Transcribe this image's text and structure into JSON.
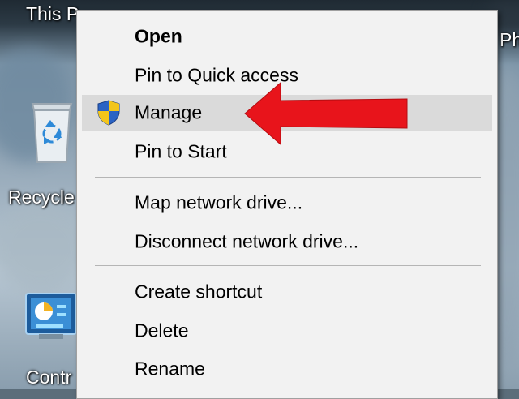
{
  "desktop": {
    "top_labels": [
      "This P",
      "Ph"
    ],
    "icons": [
      {
        "name": "recycle-bin",
        "label": "Recycle"
      },
      {
        "name": "control-panel",
        "label": "Contr"
      }
    ]
  },
  "context_menu": {
    "items": [
      {
        "label": "Open",
        "bold": true
      },
      {
        "label": "Pin to Quick access"
      },
      {
        "label": "Manage",
        "icon": "shield-icon",
        "highlighted": true
      },
      {
        "label": "Pin to Start"
      },
      {
        "label": "Map network drive..."
      },
      {
        "label": "Disconnect network drive..."
      },
      {
        "label": "Create shortcut"
      },
      {
        "label": "Delete"
      },
      {
        "label": "Rename"
      }
    ]
  },
  "colors": {
    "menu_background": "#f2f2f2",
    "highlight": "#dadada",
    "arrow": "#e8141b",
    "shield_blue": "#2a63c4",
    "shield_yellow": "#f3c51b"
  },
  "annotation": {
    "icon": "red-arrow-icon"
  }
}
